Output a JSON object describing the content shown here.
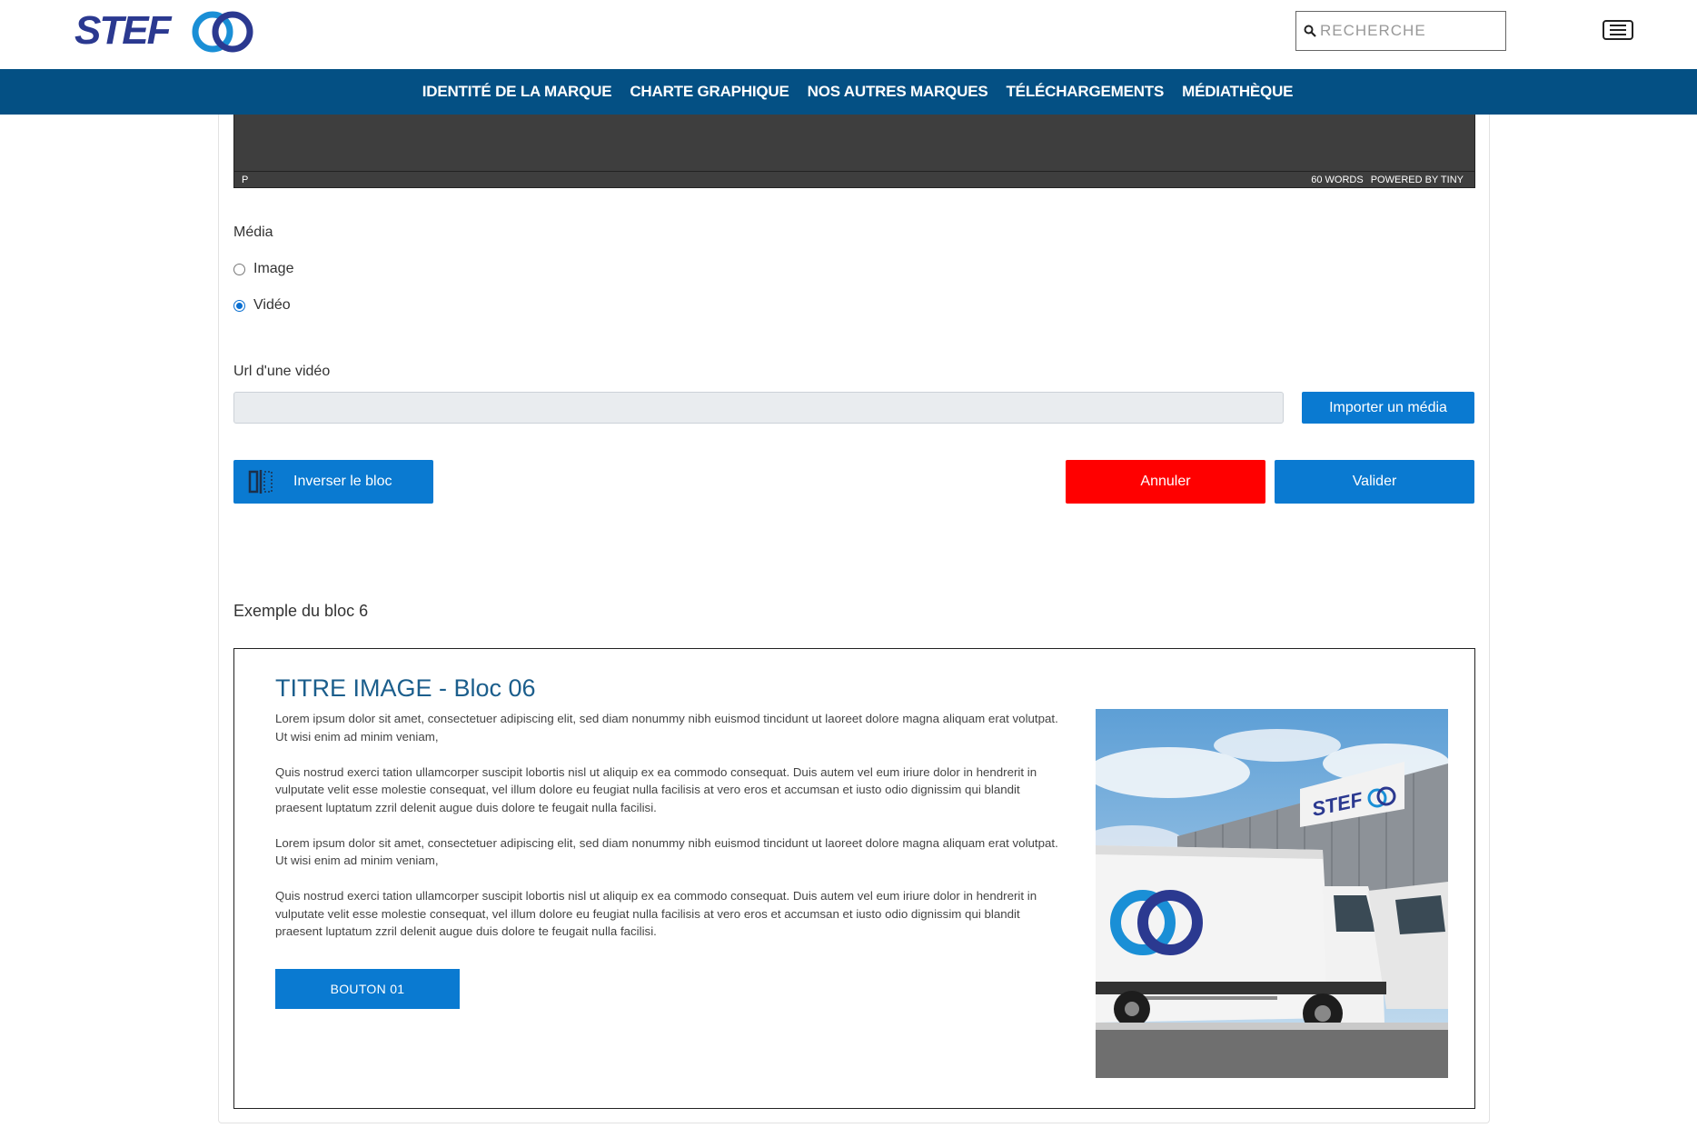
{
  "header": {
    "logo_text": "STEF",
    "search_placeholder": "RECHERCHE"
  },
  "nav": {
    "items": [
      "IDENTITÉ DE LA MARQUE",
      "CHARTE GRAPHIQUE",
      "NOS AUTRES MARQUES",
      "TÉLÉCHARGEMENTS",
      "MÉDIATHÈQUE"
    ]
  },
  "editor": {
    "path": "P",
    "word_count": "60 WORDS",
    "powered": "POWERED BY TINY"
  },
  "form": {
    "media_label": "Média",
    "radio_image": "Image",
    "radio_video": "Vidéo",
    "selected_media": "Vidéo",
    "url_label": "Url d'une vidéo",
    "url_value": "",
    "import_button": "Importer un média",
    "invert_button": "Inverser le bloc",
    "cancel_button": "Annuler",
    "validate_button": "Valider"
  },
  "example": {
    "label": "Exemple du bloc 6",
    "title": "TITRE IMAGE - Bloc 06",
    "paragraphs": [
      "Lorem ipsum dolor sit amet, consectetuer adipiscing elit, sed diam nonummy nibh euismod tincidunt ut laoreet dolore magna aliquam erat volutpat. Ut wisi enim ad minim veniam,",
      "Quis nostrud exerci tation ullamcorper suscipit lobortis nisl ut aliquip ex ea commodo consequat. Duis autem vel eum iriure dolor in hendrerit in vulputate velit esse molestie consequat, vel illum dolore eu feugiat nulla facilisis at vero eros et accumsan et iusto odio dignissim qui blandit praesent luptatum zzril delenit augue duis dolore te feugait nulla facilisi.",
      "Lorem ipsum dolor sit amet, consectetuer adipiscing elit, sed diam nonummy nibh euismod tincidunt ut laoreet dolore magna aliquam erat volutpat. Ut wisi enim ad minim veniam,",
      "Quis nostrud exerci tation ullamcorper suscipit lobortis nisl ut aliquip ex ea commodo consequat. Duis autem vel eum iriure dolor in hendrerit in vulputate velit esse molestie consequat, vel illum dolore eu feugiat nulla facilisis at vero eros et accumsan et iusto odio dignissim qui blandit praesent luptatum zzril delenit augue duis dolore te feugait nulla facilisi."
    ],
    "button": "BOUTON 01",
    "image_sign_text": "STEF"
  },
  "colors": {
    "nav_bg": "#045084",
    "primary_button": "#0a7ad1",
    "cancel_button": "#ff0000",
    "title_blue": "#1b5e8c"
  }
}
